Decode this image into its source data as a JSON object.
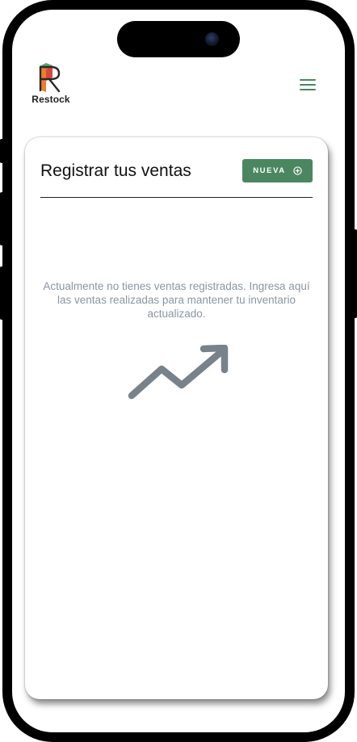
{
  "app": {
    "logo_text": "Restock",
    "logo_icon": "restock-r-logo",
    "menu_icon": "hamburger-menu-icon"
  },
  "sales_card": {
    "title": "Registrar tus ventas",
    "new_button_label": "NUEVA",
    "new_button_icon": "plus-circle-icon",
    "empty_message": "Actualmente no tienes ventas registradas. Ingresa aquí las ventas realizadas para mantener tu inventario actualizado.",
    "empty_icon": "trending-up-icon"
  },
  "colors": {
    "accent": "#4a8760",
    "muted_text": "#8a96a1",
    "icon_gray": "#77828b",
    "logo_orange": "#f07c2c",
    "logo_red": "#d9473a",
    "logo_green": "#5aa35e"
  }
}
